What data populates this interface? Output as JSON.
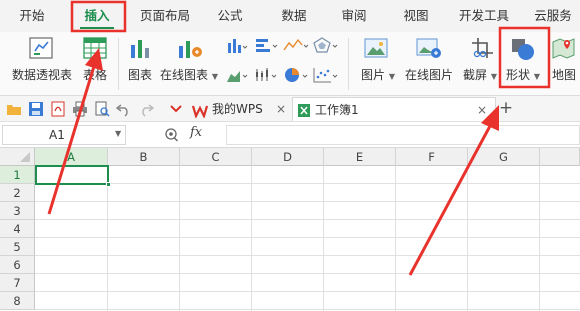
{
  "menu": {
    "tabs": [
      "开始",
      "插入",
      "页面布局",
      "公式",
      "数据",
      "审阅",
      "视图",
      "开发工具",
      "云服务"
    ],
    "active_tab": "插入"
  },
  "ribbon": {
    "pivot_table": "数据透视表",
    "table": "表格",
    "chart": "图表",
    "online_chart": "在线图表",
    "picture": "图片",
    "online_picture": "在线图片",
    "screenshot": "截屏",
    "shapes": "形状",
    "map": "地图"
  },
  "tabs": {
    "wps_tab": "我的WPS",
    "workbook_tab": "工作簿1",
    "close_glyph": "×",
    "new_tab_glyph": "+"
  },
  "formula_bar": {
    "cell_ref": "A1",
    "fx": "fx"
  },
  "grid": {
    "columns": [
      "A",
      "B",
      "C",
      "D",
      "E",
      "F",
      "G"
    ],
    "rows": [
      "1",
      "2",
      "3",
      "4",
      "5",
      "6",
      "7",
      "8"
    ],
    "selected_cell": "A1"
  },
  "colors": {
    "accent_green": "#1e8e4e",
    "annotation_red": "#e8322b",
    "wps_red": "#d9342b"
  }
}
